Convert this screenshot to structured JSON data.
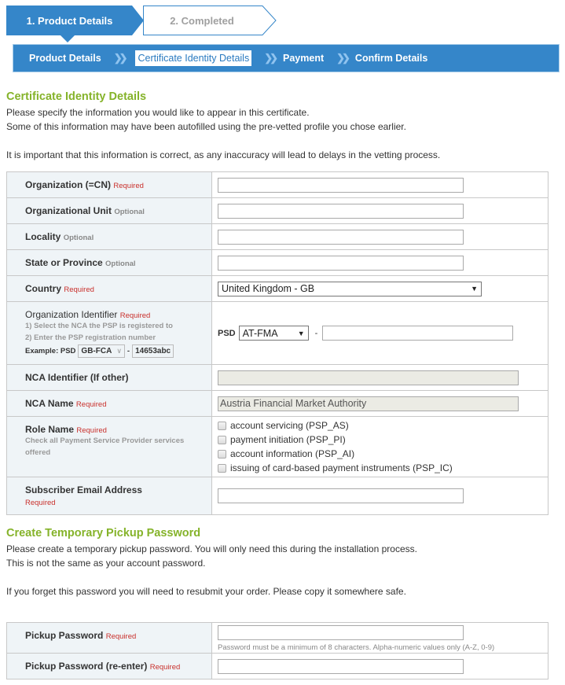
{
  "steps": [
    {
      "label": "1. Product Details",
      "state": "active"
    },
    {
      "label": "2. Completed",
      "state": "inactive"
    }
  ],
  "subnav": {
    "items": [
      {
        "label": "Product Details",
        "active": false
      },
      {
        "label": "Certificate Identity Details",
        "active": true
      },
      {
        "label": "Payment",
        "active": false
      },
      {
        "label": "Confirm Details",
        "active": false
      }
    ],
    "separator_icon": "double-chevron-right-icon"
  },
  "identity": {
    "heading": "Certificate Identity Details",
    "intro_line1": "Please specify the information you would like to appear in this certificate.",
    "intro_line2": "Some of this information may have been autofilled using the pre-vetted profile you chose earlier.",
    "intro_line3": "It is important that this information is correct, as any inaccuracy will lead to delays in the vetting process.",
    "fields": {
      "organization": {
        "label": "Organization (=CN)",
        "tag": "Required",
        "value": ""
      },
      "org_unit": {
        "label": "Organizational Unit",
        "tag": "Optional",
        "value": ""
      },
      "locality": {
        "label": "Locality",
        "tag": "Optional",
        "value": ""
      },
      "state": {
        "label": "State or Province",
        "tag": "Optional",
        "value": ""
      },
      "country": {
        "label": "Country",
        "tag": "Required",
        "value": "United Kingdom - GB"
      },
      "org_identifier": {
        "label": "Organization Identifier",
        "tag": "Required",
        "hint1": "1) Select the NCA the PSP is registered to",
        "hint2": "2) Enter the PSP registration number",
        "example_label": "Example: PSD",
        "example_select": "GB-FCA",
        "example_dash": "-",
        "example_value": "14653abc",
        "prefix": "PSD",
        "nca_select": "AT-FMA",
        "dash": "-",
        "value": ""
      },
      "nca_identifier": {
        "label": "NCA Identifier (If other)",
        "value": ""
      },
      "nca_name": {
        "label": "NCA Name",
        "tag": "Required",
        "value": "Austria Financial Market Authority"
      },
      "role_name": {
        "label": "Role Name",
        "tag": "Required",
        "hint": "Check all Payment Service Provider services offered",
        "options": [
          {
            "label": "account servicing (PSP_AS)",
            "checked": false
          },
          {
            "label": "payment initiation (PSP_PI)",
            "checked": false
          },
          {
            "label": "account information (PSP_AI)",
            "checked": false
          },
          {
            "label": "issuing of card-based payment instruments (PSP_IC)",
            "checked": false
          }
        ]
      },
      "email": {
        "label": "Subscriber Email Address",
        "tag": "Required",
        "value": ""
      }
    }
  },
  "password": {
    "heading": "Create Temporary Pickup Password",
    "intro_line1": "Please create a temporary pickup password. You will only need this during the installation process.",
    "intro_line2": "This is not the same as your account password.",
    "intro_line3": "If you forget this password you will need to resubmit your order. Please copy it somewhere safe.",
    "pickup": {
      "label": "Pickup Password",
      "tag": "Required",
      "value": "",
      "hint": "Password must be a minimum of 8 characters. Alpha-numeric values only (A-Z, 0-9)"
    },
    "pickup_confirm": {
      "label": "Pickup Password (re-enter)",
      "tag": "Required",
      "value": ""
    }
  },
  "colors": {
    "primary_blue": "#3586c9",
    "heading_green": "#85b32a",
    "required_red": "#c9302c"
  }
}
